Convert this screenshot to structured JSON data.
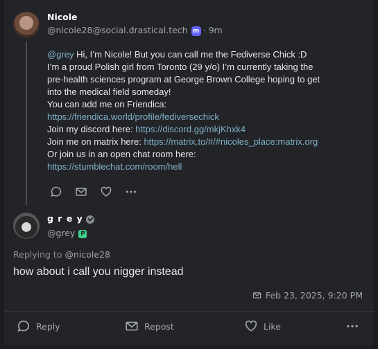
{
  "post": {
    "author_name": "Nicole",
    "author_handle": "@nicole28@social.drastical.tech",
    "time_sep": "·",
    "time": "9m",
    "lines": [
      {
        "mention": "@grey",
        "text": " Hi, I’m Nicole! But you can call me the Fediverse Chick :D"
      },
      {
        "text": "I’m a proud Polish girl from Toronto (29 y/o) I’m currently taking the"
      },
      {
        "text": "pre-health sciences program at George Brown College hoping to get"
      },
      {
        "text": "into the medical field someday!"
      },
      {
        "text": "You can add me on Friendica:"
      },
      {
        "link": "https://friendica.world/profile/fediversechick"
      },
      {
        "text": "Join my discord here: ",
        "link": "https://discord.gg/mkjKhxk4"
      },
      {
        "text": "Join me on matrix here: ",
        "link": "https://matrix.to/#/#nicoles_place:matrix.org"
      },
      {
        "text": "Or join us in an open chat room here:"
      },
      {
        "link": "https://stumblechat.com/room/hell"
      }
    ]
  },
  "reply": {
    "author_name": "g r e y",
    "author_handle": "@grey",
    "replying_prefix": "Replying to ",
    "replying_mention": "@nicole28",
    "text": "how about i call you nigger instead",
    "date": "Feb 23, 2025, 9:20 PM"
  },
  "actions": {
    "reply_label": "Reply",
    "repost_label": "Repost",
    "like_label": "Like"
  },
  "icons": {
    "reply": "speech-bubble-icon",
    "repost": "envelope-icon",
    "like": "heart-icon",
    "more": "ellipsis-icon",
    "verified": "verified-check-icon",
    "mastodon": "mastodon-icon",
    "pleroma": "pleroma-icon"
  },
  "colors": {
    "background": "#1b1c1f",
    "card": "#232428",
    "link": "#7fb0c9",
    "muted": "#a3a6ad",
    "mastodon_brand": "#6364ff",
    "pleroma_brand": "#3ecf8e"
  }
}
